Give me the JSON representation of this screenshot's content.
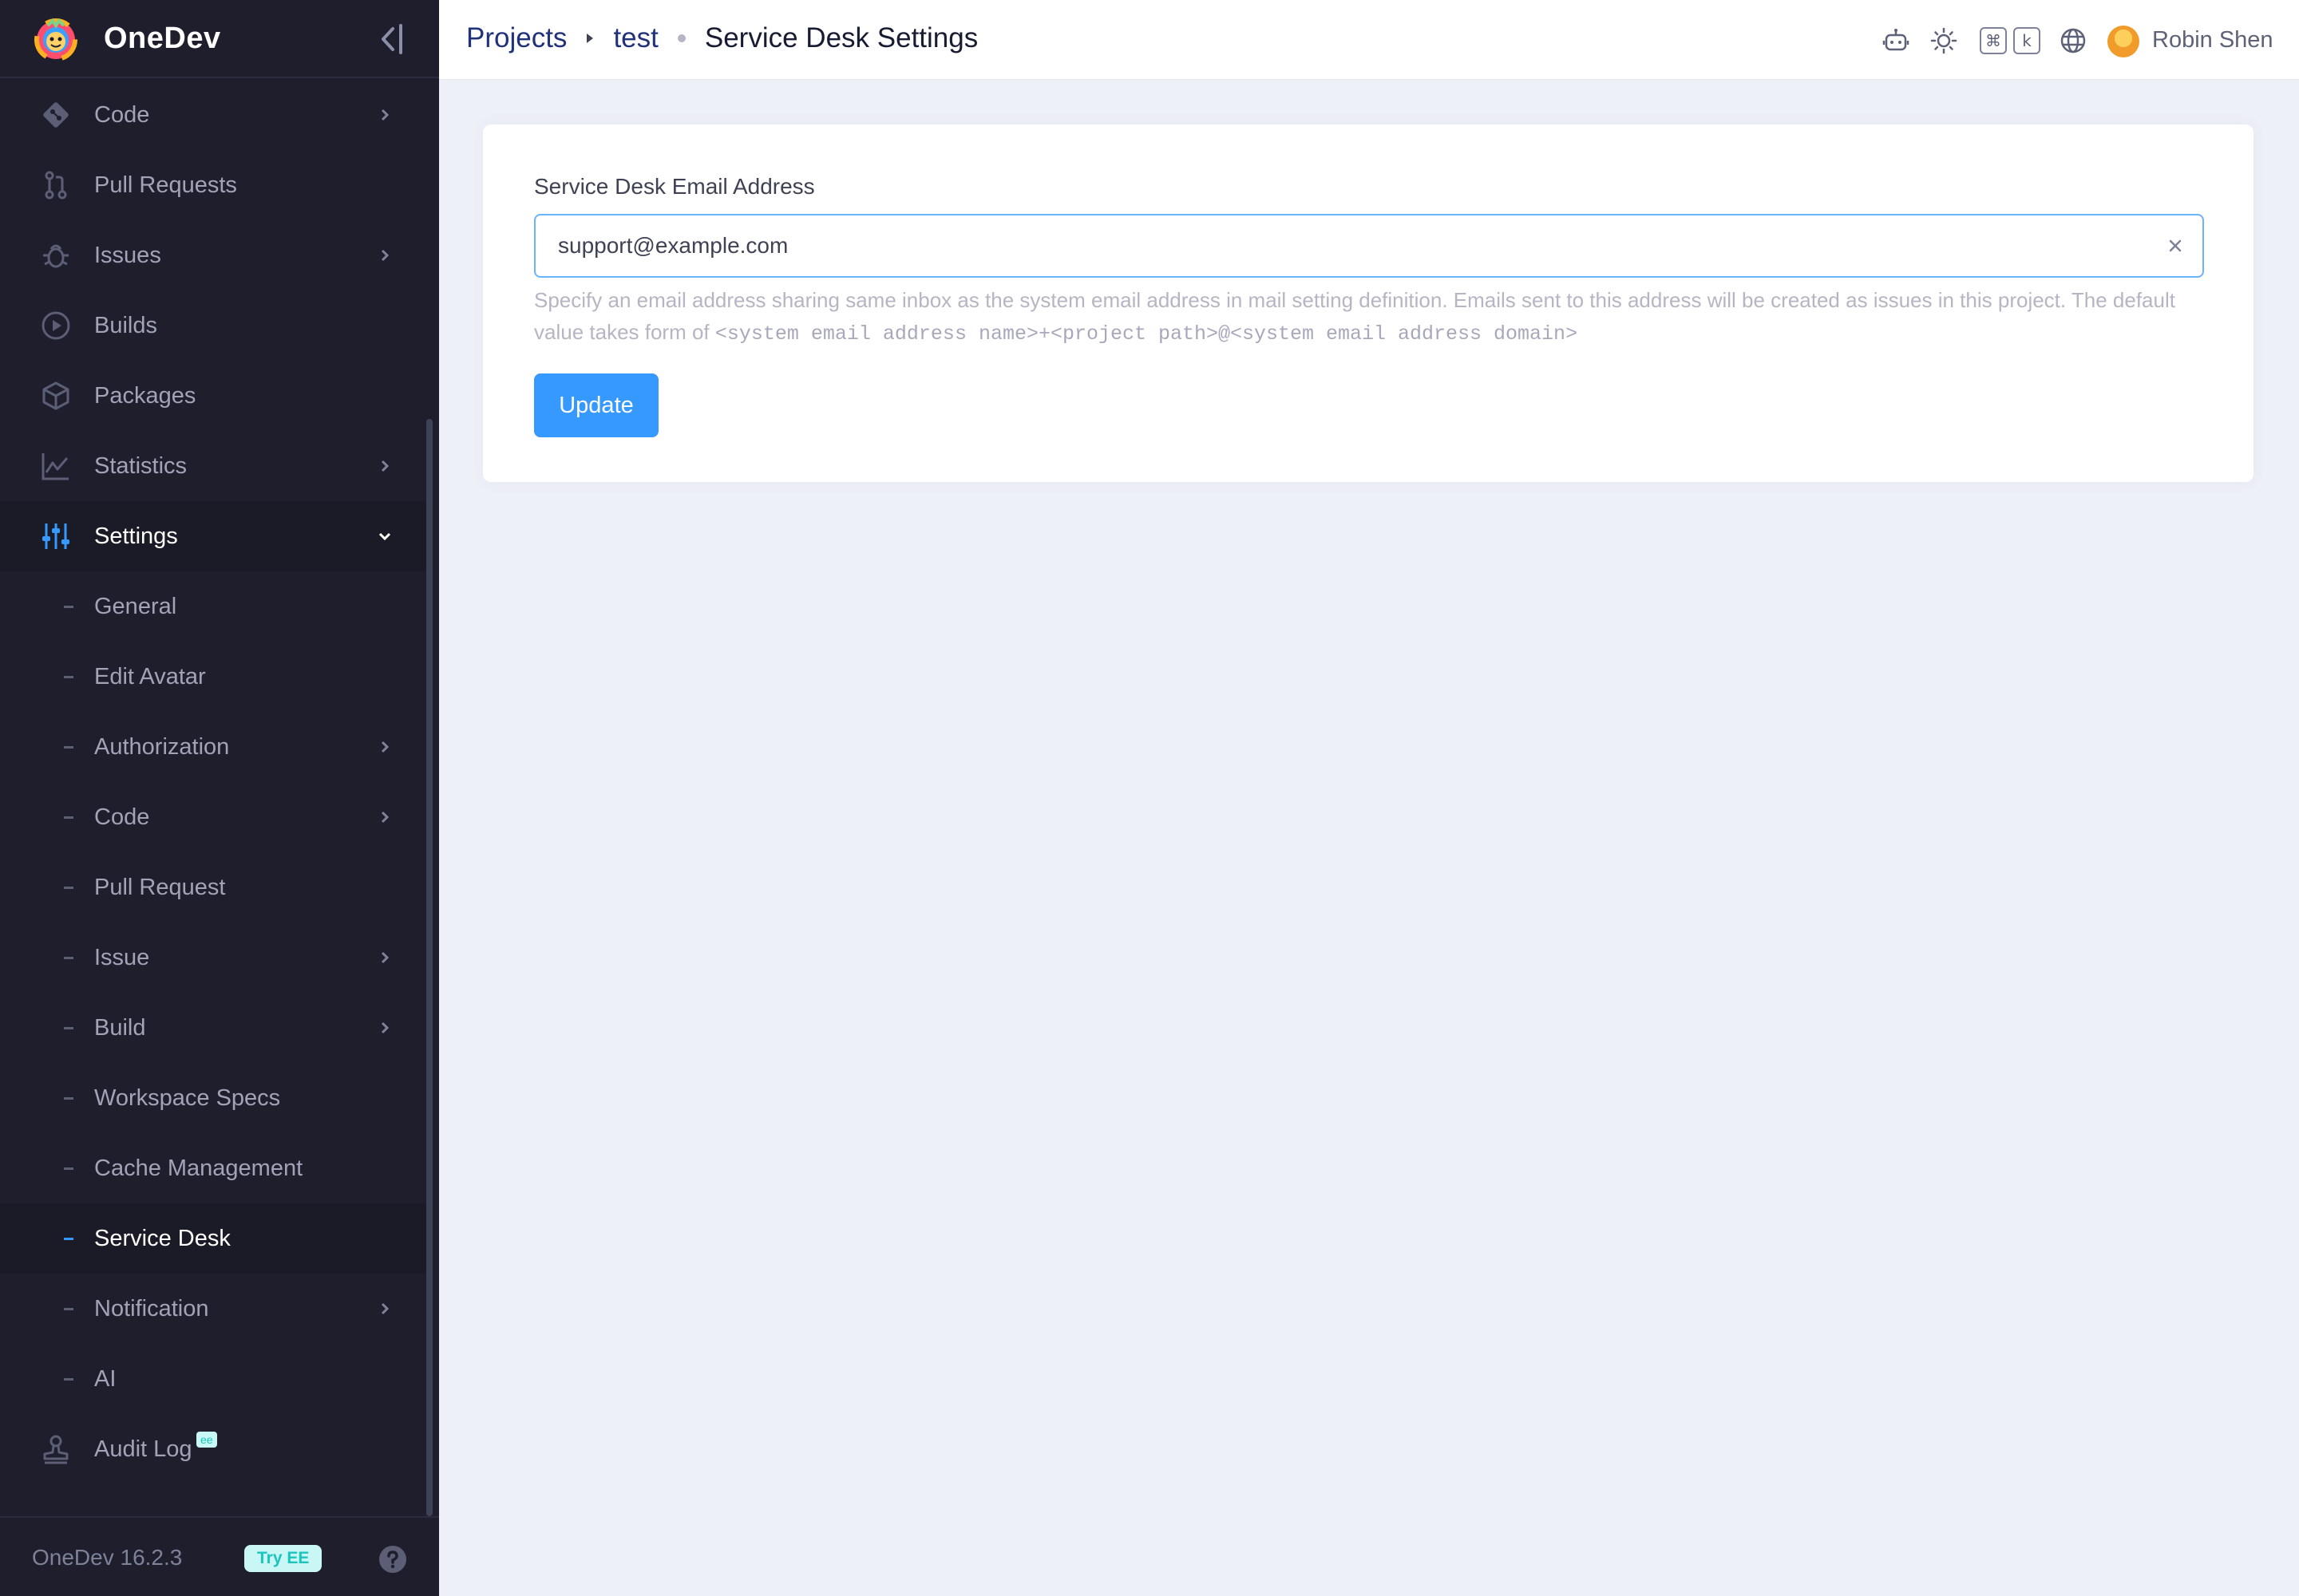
{
  "brand": {
    "name": "OneDev"
  },
  "sidebar": {
    "items": [
      {
        "label": "Code",
        "icon": "git-icon",
        "has_chevron": true
      },
      {
        "label": "Pull Requests",
        "icon": "pull-request-icon",
        "has_chevron": false
      },
      {
        "label": "Issues",
        "icon": "bug-icon",
        "has_chevron": true
      },
      {
        "label": "Builds",
        "icon": "play-circle-icon",
        "has_chevron": false
      },
      {
        "label": "Packages",
        "icon": "package-icon",
        "has_chevron": false
      },
      {
        "label": "Statistics",
        "icon": "chart-line-icon",
        "has_chevron": true
      },
      {
        "label": "Settings",
        "icon": "sliders-icon",
        "expanded": true
      }
    ],
    "settings_sub": [
      {
        "label": "General",
        "has_chevron": false
      },
      {
        "label": "Edit Avatar",
        "has_chevron": false
      },
      {
        "label": "Authorization",
        "has_chevron": true
      },
      {
        "label": "Code",
        "has_chevron": true
      },
      {
        "label": "Pull Request",
        "has_chevron": false
      },
      {
        "label": "Issue",
        "has_chevron": true
      },
      {
        "label": "Build",
        "has_chevron": true
      },
      {
        "label": "Workspace Specs",
        "has_chevron": false
      },
      {
        "label": "Cache Management",
        "has_chevron": false
      },
      {
        "label": "Service Desk",
        "has_chevron": false,
        "current": true
      },
      {
        "label": "Notification",
        "has_chevron": true
      },
      {
        "label": "AI",
        "has_chevron": false
      }
    ],
    "audit_log": {
      "label": "Audit Log",
      "badge": "ee",
      "icon": "stamp-icon"
    },
    "footer": {
      "version": "OneDev 16.2.3",
      "try_ee": "Try EE"
    }
  },
  "topbar": {
    "breadcrumb": {
      "projects": "Projects",
      "project": "test",
      "page": "Service Desk Settings"
    },
    "shortcut_keys": [
      "⌘",
      "k"
    ],
    "user_name": "Robin Shen"
  },
  "form": {
    "label": "Service Desk Email Address",
    "email_value": "support@example.com",
    "help_text": "Specify an email address sharing same inbox as the system email address in mail setting definition. Emails sent to this address will be created as issues in this project. The default value takes form of ",
    "help_code": "<system email address name>+<project path>@<system email address domain>",
    "submit_label": "Update"
  },
  "colors": {
    "sidebar_bg": "#1e1e2d",
    "accent": "#3699ff",
    "page_bg": "#eef0f8",
    "ee_badge_bg": "#c9f7f5",
    "ee_badge_text": "#1bc5bd"
  }
}
